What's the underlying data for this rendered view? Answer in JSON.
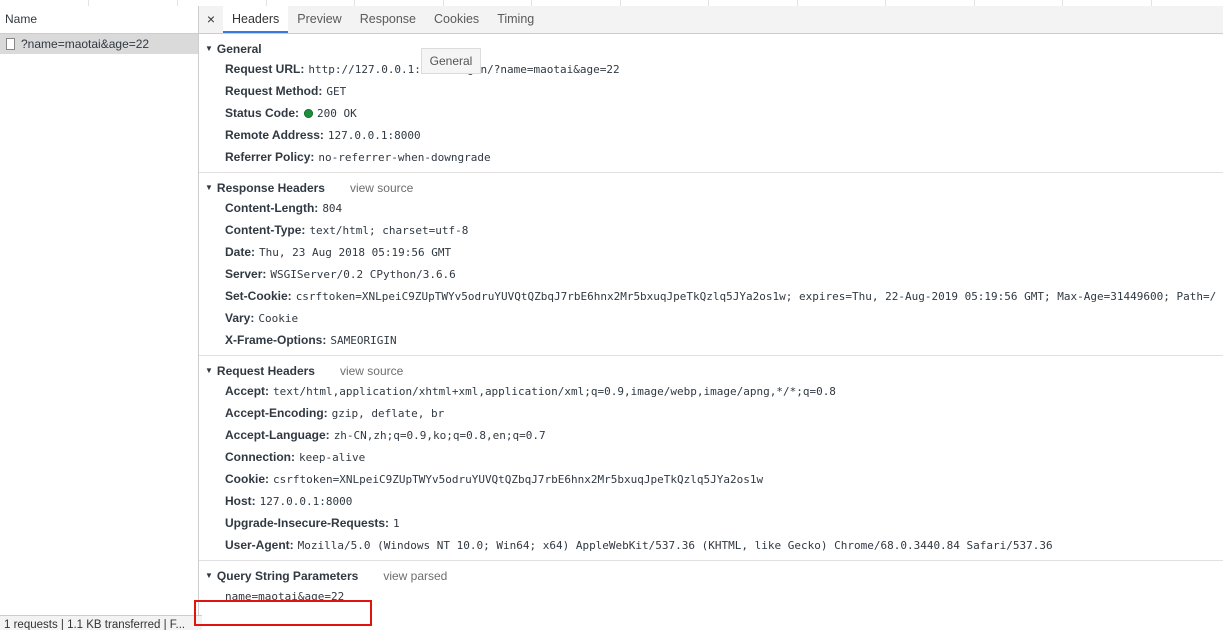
{
  "left_pane": {
    "column_header": "Name",
    "request_name": "?name=maotai&age=22",
    "status_bar": "1 requests  |  1.1 KB transferred  |  F..."
  },
  "tabs": {
    "close_symbol": "×",
    "items": [
      "Headers",
      "Preview",
      "Response",
      "Cookies",
      "Timing"
    ],
    "active": "Headers"
  },
  "tooltip": "General",
  "general": {
    "title": "General",
    "rows": [
      {
        "key": "Request URL:",
        "value": "http://127.0.0.1:8000/login/?name=maotai&age=22"
      },
      {
        "key": "Request Method:",
        "value": "GET"
      },
      {
        "key": "Status Code:",
        "value": "200 OK"
      },
      {
        "key": "Remote Address:",
        "value": "127.0.0.1:8000"
      },
      {
        "key": "Referrer Policy:",
        "value": "no-referrer-when-downgrade"
      }
    ]
  },
  "response_headers": {
    "title": "Response Headers",
    "link": "view source",
    "rows": [
      {
        "key": "Content-Length:",
        "value": "804"
      },
      {
        "key": "Content-Type:",
        "value": "text/html; charset=utf-8"
      },
      {
        "key": "Date:",
        "value": "Thu, 23 Aug 2018 05:19:56 GMT"
      },
      {
        "key": "Server:",
        "value": "WSGIServer/0.2 CPython/3.6.6"
      },
      {
        "key": "Set-Cookie:",
        "value": "csrftoken=XNLpeiC9ZUpTWYv5odruYUVQtQZbqJ7rbE6hnx2Mr5bxuqJpeTkQzlq5JYa2os1w; expires=Thu, 22-Aug-2019 05:19:56 GMT; Max-Age=31449600; Path=/"
      },
      {
        "key": "Vary:",
        "value": "Cookie"
      },
      {
        "key": "X-Frame-Options:",
        "value": "SAMEORIGIN"
      }
    ]
  },
  "request_headers": {
    "title": "Request Headers",
    "link": "view source",
    "rows": [
      {
        "key": "Accept:",
        "value": "text/html,application/xhtml+xml,application/xml;q=0.9,image/webp,image/apng,*/*;q=0.8"
      },
      {
        "key": "Accept-Encoding:",
        "value": "gzip, deflate, br"
      },
      {
        "key": "Accept-Language:",
        "value": "zh-CN,zh;q=0.9,ko;q=0.8,en;q=0.7"
      },
      {
        "key": "Connection:",
        "value": "keep-alive"
      },
      {
        "key": "Cookie:",
        "value": "csrftoken=XNLpeiC9ZUpTWYv5odruYUVQtQZbqJ7rbE6hnx2Mr5bxuqJpeTkQzlq5JYa2os1w"
      },
      {
        "key": "Host:",
        "value": "127.0.0.1:8000"
      },
      {
        "key": "Upgrade-Insecure-Requests:",
        "value": "1"
      },
      {
        "key": "User-Agent:",
        "value": "Mozilla/5.0 (Windows NT 10.0; Win64; x64) AppleWebKit/537.36 (KHTML, like Gecko) Chrome/68.0.3440.84 Safari/537.36"
      }
    ]
  },
  "query_string": {
    "title": "Query String Parameters",
    "link": "view parsed",
    "value": "name=maotai&age=22"
  },
  "colors": {
    "status_dot": "#1e8e3e",
    "highlight": "#e0140e",
    "active_tab": "#3879d9"
  }
}
